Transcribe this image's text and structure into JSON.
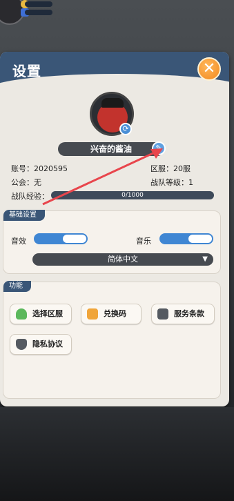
{
  "settings": {
    "title": "设置",
    "player_name": "兴奋的酱油",
    "account_label": "账号：",
    "account_value": "2020595",
    "server_label": "区服：",
    "server_value": "20服",
    "guild_label": "公会：",
    "guild_value": "无",
    "team_level_label": "战队等级：",
    "team_level_value": "1",
    "xp_label": "战队经验：",
    "xp_text": "0/1000",
    "xp_fraction": 0
  },
  "basic": {
    "label": "基础设置",
    "sfx_label": "音效",
    "music_label": "音乐",
    "sfx_on": true,
    "music_on": true,
    "language": "简体中文"
  },
  "functions": {
    "label": "功能",
    "buttons": [
      {
        "label": "选择区服",
        "icon": "user-server-icon"
      },
      {
        "label": "兑换码",
        "icon": "gift-icon"
      },
      {
        "label": "服务条款",
        "icon": "book-icon"
      },
      {
        "label": "隐私协议",
        "icon": "shield-icon"
      }
    ]
  },
  "colors": {
    "header": "#3a5677",
    "close": "#f2891f",
    "toggle": "#3f86d3",
    "arrow": "#e8454c"
  }
}
